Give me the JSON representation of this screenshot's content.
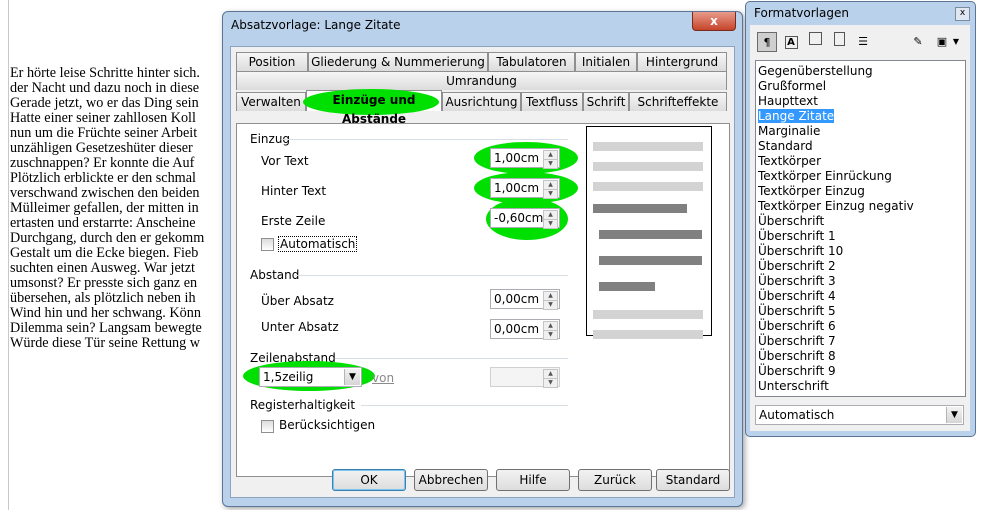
{
  "document_lines": [
    "Er hörte leise Schritte hinter sich.",
    "der Nacht und dazu noch in diese",
    "Gerade jetzt, wo er das Ding sein",
    "Hatte einer seiner zahllosen Koll",
    "nun um die Früchte seiner Arbeit",
    "unzähligen Gesetzeshüter dieser",
    "zuschnappen? Er konnte die Auf",
    "Plötzlich erblickte er den schmal",
    "verschwand zwischen den beiden",
    "Mülleimer gefallen, der mitten in",
    "ertasten und erstarrte: Anscheine",
    "Durchgang, durch den er gekomm",
    "Gestalt um die Ecke biegen. Fieb",
    "suchten einen Ausweg. War jetzt",
    "umsonst? Er presste sich ganz en",
    "übersehen, als plötzlich neben ih",
    "Wind hin und her schwang. Könn",
    "Dilemma sein? Langsam bewegte",
    "Würde diese Tür seine Rettung w"
  ],
  "dialog": {
    "title": "Absatzvorlage: Lange Zitate",
    "close": "x",
    "tabs_row1": [
      "Position",
      "Gliederung & Nummerierung",
      "Tabulatoren",
      "Initialen",
      "Hintergrund"
    ],
    "tabs_row2": [
      "Umrandung"
    ],
    "tabs_row3": [
      "Verwalten",
      "Einzüge und Abstände",
      "Ausrichtung",
      "Textfluss",
      "Schrift",
      "Schrifteffekte"
    ],
    "active_tab": "Einzüge und Abstände",
    "einzug": {
      "heading": "Einzug",
      "vor_text_label": "Vor Text",
      "vor_text_value": "1,00cm",
      "hinter_text_label": "Hinter Text",
      "hinter_text_value": "1,00cm",
      "erste_zeile_label": "Erste Zeile",
      "erste_zeile_value": "-0,60cm",
      "automatisch_label": "Automatisch",
      "automatisch_checked": false
    },
    "abstand": {
      "heading": "Abstand",
      "ueber_label": "Über Absatz",
      "ueber_value": "0,00cm",
      "unter_label": "Unter Absatz",
      "unter_value": "0,00cm"
    },
    "zeilenabstand": {
      "heading": "Zeilenabstand",
      "selected": "1,5zeilig",
      "von_label": "von",
      "von_value": ""
    },
    "registerhaltigkeit": {
      "heading": "Registerhaltigkeit",
      "beruecksichtigen_label": "Berücksichtigen",
      "checked": false
    },
    "buttons": {
      "ok": "OK",
      "abbrechen": "Abbrechen",
      "hilfe": "Hilfe",
      "zurueck": "Zurück",
      "standard": "Standard"
    },
    "highlight_color": "#00e000"
  },
  "styles_panel": {
    "title": "Formatvorlagen",
    "close": "x",
    "toolbar_icons": [
      "paragraph-styles-icon",
      "character-styles-icon",
      "frame-styles-icon",
      "page-styles-icon",
      "list-styles-icon",
      "fill-format-icon",
      "new-style-icon",
      "dropdown-arrow-icon"
    ],
    "items": [
      "Gegenüberstellung",
      "Grußformel",
      "Haupttext",
      "Lange Zitate",
      "Marginalie",
      "Standard",
      "Textkörper",
      "Textkörper Einrückung",
      "Textkörper Einzug",
      "Textkörper Einzug negativ",
      "Überschrift",
      "Überschrift 1",
      "Überschrift 10",
      "Überschrift 2",
      "Überschrift 3",
      "Überschrift 4",
      "Überschrift 5",
      "Überschrift 6",
      "Überschrift 7",
      "Überschrift 8",
      "Überschrift 9",
      "Unterschrift"
    ],
    "selected_item": "Lange Zitate",
    "filter": "Automatisch",
    "selected_color": "#3399ff"
  }
}
